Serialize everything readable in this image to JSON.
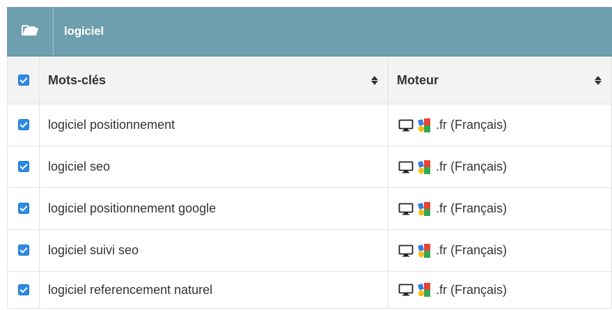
{
  "group": {
    "title": "logiciel"
  },
  "table": {
    "headers": {
      "keywords": "Mots-clés",
      "engine": "Moteur"
    },
    "rows": [
      {
        "keyword": "logiciel positionnement",
        "engine": ".fr (Français)"
      },
      {
        "keyword": "logiciel seo",
        "engine": ".fr (Français)"
      },
      {
        "keyword": "logiciel positionnement google",
        "engine": ".fr (Français)"
      },
      {
        "keyword": "logiciel suivi seo",
        "engine": ".fr (Français)"
      },
      {
        "keyword": "logiciel referencement naturel",
        "engine": ".fr (Français)"
      }
    ]
  },
  "icons": {
    "folder": "folder-open-icon",
    "sort": "sort-icon",
    "device": "desktop-monitor-icon",
    "engine": "google-logo-icon"
  },
  "colors": {
    "header_bg": "#6e9fae",
    "checkbox": "#2d8ae8",
    "table_head_bg": "#f3f3f3"
  }
}
